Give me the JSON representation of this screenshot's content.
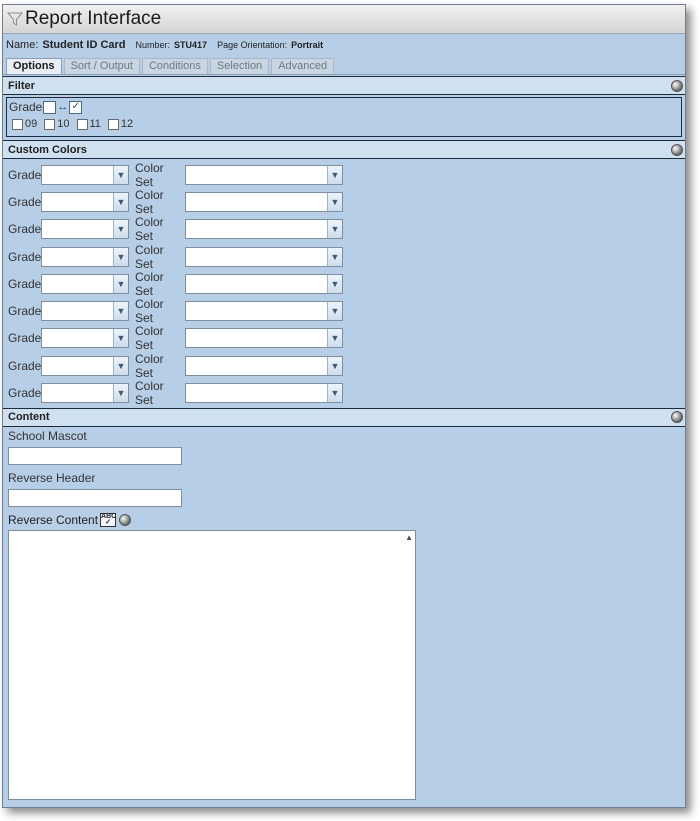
{
  "window": {
    "title": "Report Interface"
  },
  "info": {
    "name_label": "Name:",
    "name_value": "Student ID Card",
    "number_label": "Number:",
    "number_value": "STU417",
    "orientation_label": "Page Orientation:",
    "orientation_value": "Portrait"
  },
  "tabs": [
    {
      "label": "Options"
    },
    {
      "label": "Sort / Output"
    },
    {
      "label": "Conditions"
    },
    {
      "label": "Selection"
    },
    {
      "label": "Advanced"
    }
  ],
  "filter": {
    "header": "Filter",
    "grade_label": "Grade",
    "grades": [
      "09",
      "10",
      "11",
      "12"
    ]
  },
  "custom_colors": {
    "header": "Custom Colors",
    "grade_label": "Grade",
    "color_set_label": "Color Set",
    "rows": 9
  },
  "content": {
    "header": "Content",
    "school_mascot_label": "School Mascot",
    "reverse_header_label": "Reverse Header",
    "reverse_content_label": "Reverse Content"
  }
}
